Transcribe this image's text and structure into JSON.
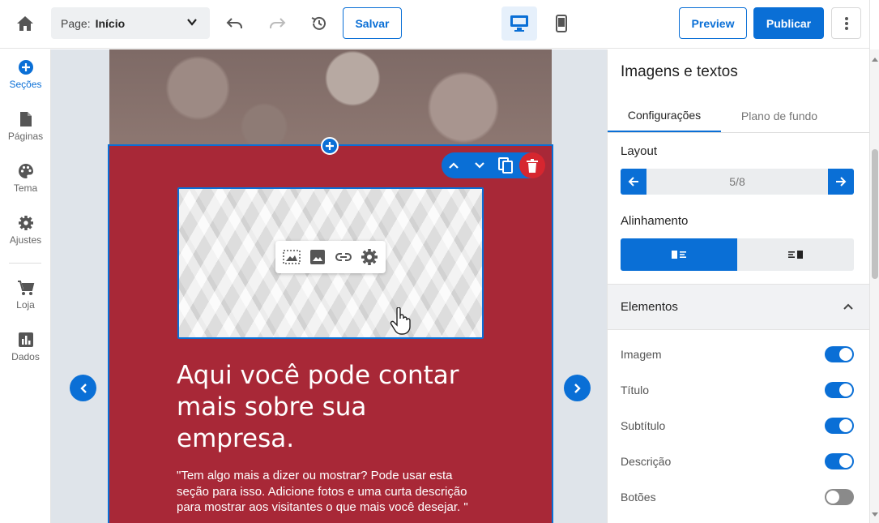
{
  "header": {
    "page_label": "Page:",
    "page_value": "Início",
    "save_label": "Salvar",
    "preview_label": "Preview",
    "publish_label": "Publicar"
  },
  "sidebar": {
    "items": [
      {
        "label": "Seções",
        "icon": "plus-circle-icon",
        "active": true
      },
      {
        "label": "Páginas",
        "icon": "file-icon",
        "active": false
      },
      {
        "label": "Tema",
        "icon": "palette-icon",
        "active": false
      },
      {
        "label": "Ajustes",
        "icon": "gear-icon",
        "active": false
      },
      {
        "label": "Loja",
        "icon": "cart-icon",
        "active": false
      },
      {
        "label": "Dados",
        "icon": "chart-icon",
        "active": false
      }
    ]
  },
  "canvas": {
    "headline": "Aqui você pode contar mais sobre sua empresa.",
    "description": "\"Tem algo mais a dizer ou mostrar? Pode usar esta seção para isso. Adicione fotos e uma curta descrição para mostrar aos visitantes o que mais você desejar. \""
  },
  "panel": {
    "title": "Imagens e textos",
    "tabs": [
      {
        "label": "Configurações",
        "active": true
      },
      {
        "label": "Plano de fundo",
        "active": false
      }
    ],
    "layout_label": "Layout",
    "layout_value": "5/8",
    "alignment_label": "Alinhamento",
    "elements_label": "Elementos",
    "elements": [
      {
        "name": "Imagem",
        "enabled": true
      },
      {
        "name": "Título",
        "enabled": true
      },
      {
        "name": "Subtítulo",
        "enabled": true
      },
      {
        "name": "Descrição",
        "enabled": true
      },
      {
        "name": "Botões",
        "enabled": false
      }
    ]
  },
  "colors": {
    "accent": "#0a6fd6",
    "section_bg": "#a82837",
    "delete": "#d6262f"
  }
}
